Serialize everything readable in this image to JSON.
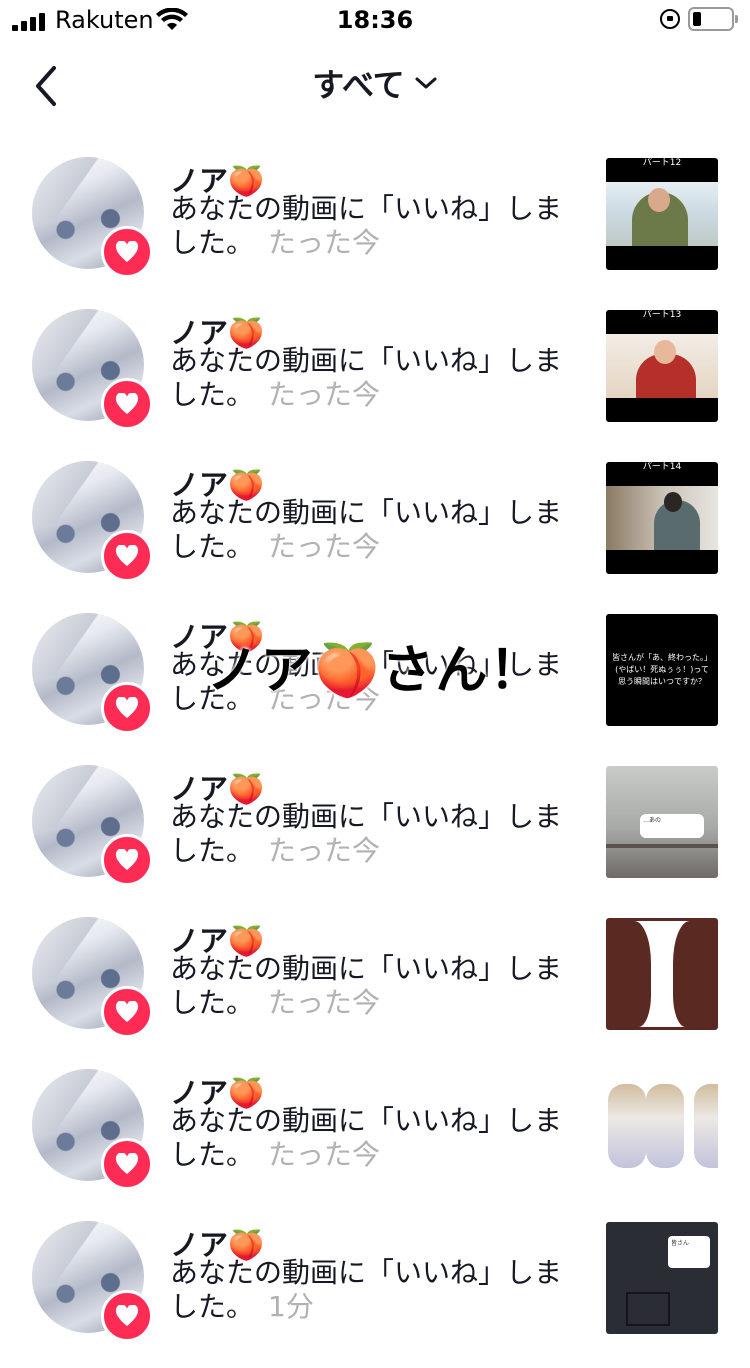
{
  "status_bar": {
    "carrier": "Rakuten",
    "time": "18:36"
  },
  "header": {
    "title": "すべて"
  },
  "notifications": [
    {
      "name": "ノア🍑",
      "message": "あなたの動画に「いいね」しました。",
      "time": "たった今",
      "thumb_label": "パート12"
    },
    {
      "name": "ノア🍑",
      "message": "あなたの動画に「いいね」しました。",
      "time": "たった今",
      "thumb_label": "パート13"
    },
    {
      "name": "ノア🍑",
      "message": "あなたの動画に「いいね」しました。",
      "time": "たった今",
      "thumb_label": "パート14"
    },
    {
      "name": "ノア🍑",
      "message": "あなたの動画に「いいね」しました。",
      "time": "たった今",
      "thumb_text": "皆さんが「あ、終わった。」(やばい！死ぬぅぅ！)って思う瞬間はいつですか？"
    },
    {
      "name": "ノア🍑",
      "message": "あなたの動画に「いいね」しました。",
      "time": "たった今",
      "thumb_text": "…あの"
    },
    {
      "name": "ノア🍑",
      "message": "あなたの動画に「いいね」しました。",
      "time": "たった今"
    },
    {
      "name": "ノア🍑",
      "message": "あなたの動画に「いいね」しました。",
      "time": "たった今"
    },
    {
      "name": "ノア🍑",
      "message": "あなたの動画に「いいね」しました。",
      "time": "1分",
      "thumb_text": "皆さん"
    }
  ],
  "overlay_text": "ノア🍑さん！",
  "colors": {
    "like_badge": "#fe2c55",
    "time_text": "#b0b0b5"
  }
}
